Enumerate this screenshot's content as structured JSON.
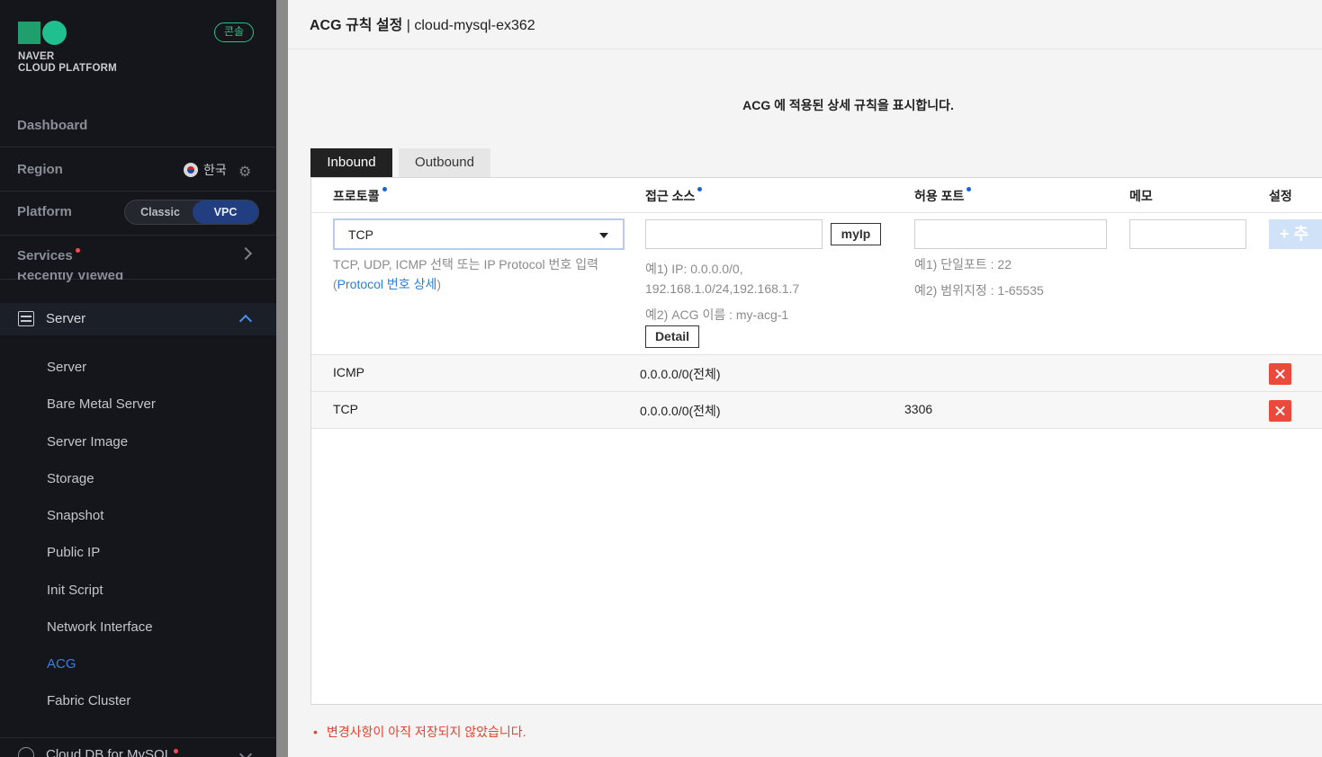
{
  "sidebar": {
    "console_badge": "콘솔",
    "logo_line1": "NAVER",
    "logo_line2": "CLOUD PLATFORM",
    "dashboard": "Dashboard",
    "region_label": "Region",
    "region_value": "한국",
    "platform_label": "Platform",
    "platform_classic": "Classic",
    "platform_vpc": "VPC",
    "services_label": "Services",
    "recently_viewed": "Recently Viewed",
    "server_section": "Server",
    "server_items": [
      "Server",
      "Bare Metal Server",
      "Server Image",
      "Storage",
      "Snapshot",
      "Public IP",
      "Init Script",
      "Network Interface",
      "ACG",
      "Fabric Cluster"
    ],
    "active_item": "ACG",
    "clouddb_label": "Cloud DB for MySQL"
  },
  "modal": {
    "title_bold": "ACG 규칙 설정",
    "title_rest": " | cloud-mysql-ex362",
    "description": "ACG 에 적용된 상세 규칙을 표시합니다.",
    "tabs": {
      "inbound": "Inbound",
      "outbound": "Outbound"
    },
    "columns": {
      "protocol": "프로토콜",
      "source": "접근 소스",
      "port": "허용 포트",
      "memo": "메모",
      "setting": "설정"
    },
    "form": {
      "protocol_value": "TCP",
      "protocol_hint_a": "TCP, UDP, ICMP 선택 또는 IP Protocol 번호 입력",
      "protocol_hint_paren_open": "(",
      "protocol_hint_link": "Protocol 번호 상세",
      "protocol_hint_paren_close": ")",
      "myip_button": "myIp",
      "source_hint1_a": "예1) IP: 0.0.0.0/0,",
      "source_hint1_b": "192.168.1.0/24,192.168.1.7",
      "source_hint2": "예2) ACG 이름 : my-acg-1",
      "detail_button": "Detail",
      "port_hint1": "예1) 단일포트 : 22",
      "port_hint2": "예2) 범위지정 : 1-65535",
      "add_button": "+ 추"
    },
    "rules": [
      {
        "protocol": "ICMP",
        "source": "0.0.0.0/0(전체)",
        "port": ""
      },
      {
        "protocol": "TCP",
        "source": "0.0.0.0/0(전체)",
        "port": "3306"
      }
    ],
    "warning": "변경사항이 아직 저장되지 않았습니다."
  },
  "colors": {
    "accent": "#2a7ed6",
    "danger": "#e94a3b",
    "brand": "#1fbf8f",
    "vpc": "#213f80"
  }
}
